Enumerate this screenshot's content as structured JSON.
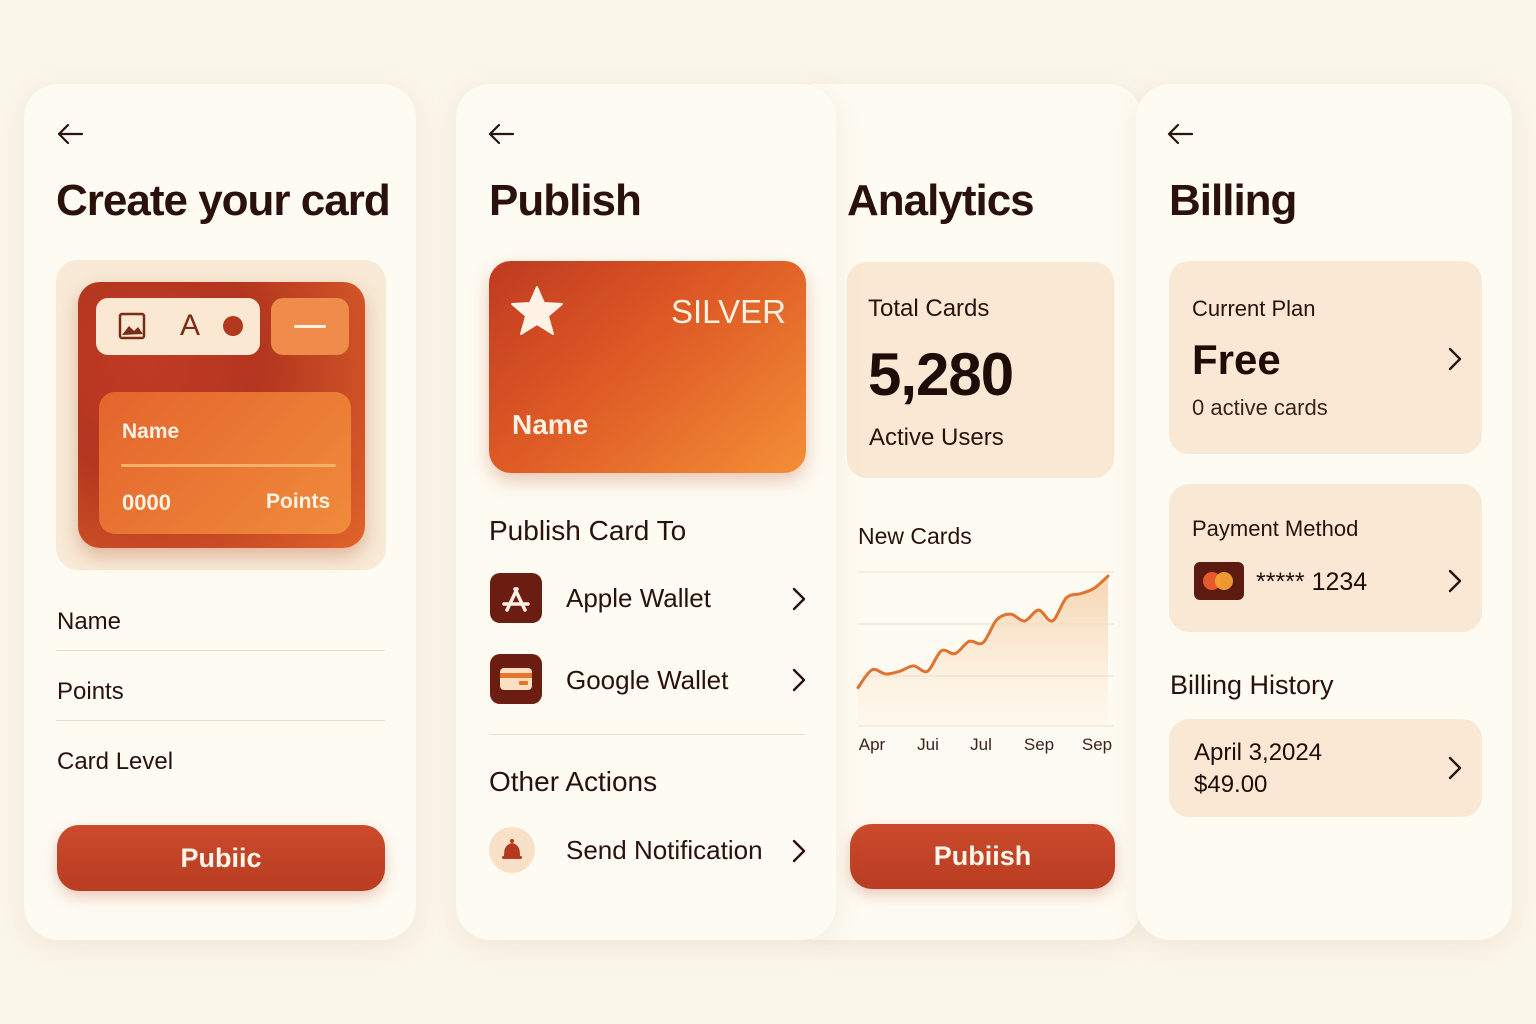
{
  "create": {
    "title": "Create your card",
    "toolbar": {
      "text_tool": "A"
    },
    "preview": {
      "name": "Name",
      "number": "0000",
      "points": "Points"
    },
    "fields": [
      "Name",
      "Points",
      "Card Level"
    ],
    "button": "Pubiic"
  },
  "publish": {
    "title": "Publish",
    "card": {
      "level": "SILVER",
      "name": "Name"
    },
    "section_title": "Publish Card To",
    "destinations": [
      "Apple Wallet",
      "Google Wallet"
    ],
    "other_title": "Other Actions",
    "actions": [
      "Send Notification"
    ]
  },
  "analytics": {
    "title": "Analytics",
    "stats": {
      "label": "Total Cards",
      "value": "5,280",
      "sub": "Active Users"
    },
    "chart_title": "New Cards",
    "button": "Pubiish"
  },
  "chart_data": {
    "type": "area",
    "title": "New Cards",
    "categories": [
      "Apr",
      "Jui",
      "Jul",
      "Sep",
      "Sep"
    ],
    "values": [
      15,
      28,
      25,
      27,
      31,
      27,
      42,
      40,
      49,
      48,
      65,
      69,
      64,
      72,
      64,
      81,
      84,
      88,
      97
    ],
    "ylim": [
      0,
      100
    ],
    "grid": true
  },
  "billing": {
    "title": "Billing",
    "plan": {
      "label": "Current Plan",
      "name": "Free",
      "sub": "0 active cards"
    },
    "payment": {
      "label": "Payment Method",
      "masked": "***** 1234"
    },
    "history_title": "Billing History",
    "history": [
      {
        "date": "April 3,2024",
        "amount": "$49.00"
      }
    ]
  },
  "colors": {
    "background": "#fbf6ea",
    "panel": "#fefbf2",
    "accent": "#c3442a",
    "card_orange": "#e4652c",
    "soft_card": "#f9e9d4",
    "text": "#2a120c"
  },
  "icons": {
    "back": "arrow-left-icon",
    "image_tool": "image-icon",
    "star": "star-icon",
    "apple_wallet": "app-store-icon",
    "google_wallet": "wallet-icon",
    "notification": "bell-icon",
    "chevron": "chevron-right-icon",
    "payment": "mastercard-icon"
  }
}
